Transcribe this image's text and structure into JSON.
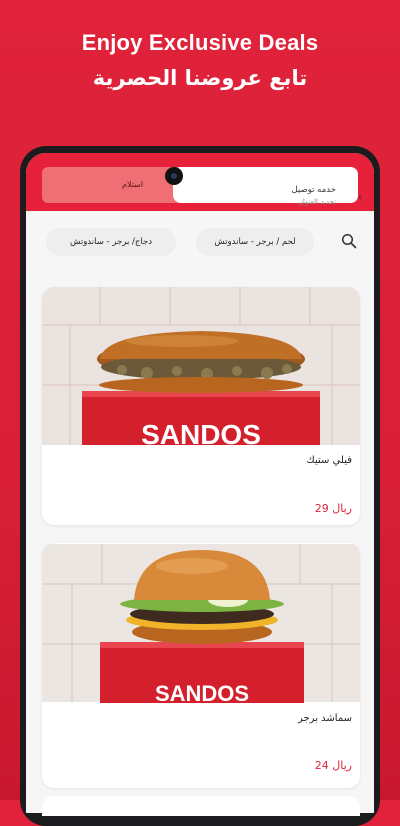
{
  "promo": {
    "title_en": "Enjoy Exclusive Deals",
    "title_ar": "تابع عروضنا الحصرية"
  },
  "order_mode": {
    "delivery_label": "خدمه توصيل",
    "delivery_sub": "تحديد العنوان",
    "pickup_label": "استلام"
  },
  "categories": [
    {
      "label": "لحم / برجر - ساندوتش"
    },
    {
      "label": "دجاج/ برجر - ساندوتش"
    }
  ],
  "products": [
    {
      "name": "فيلي ستيك",
      "price": "29 ريال"
    },
    {
      "name": "سماشد برجر",
      "price": "24 ريال"
    }
  ],
  "brand_box_text": "SANDOS",
  "icons": {
    "search": "search-icon",
    "chevron": "chevron-left-icon"
  },
  "colors": {
    "brand_red": "#e0233a",
    "price_red": "#e0243a"
  }
}
